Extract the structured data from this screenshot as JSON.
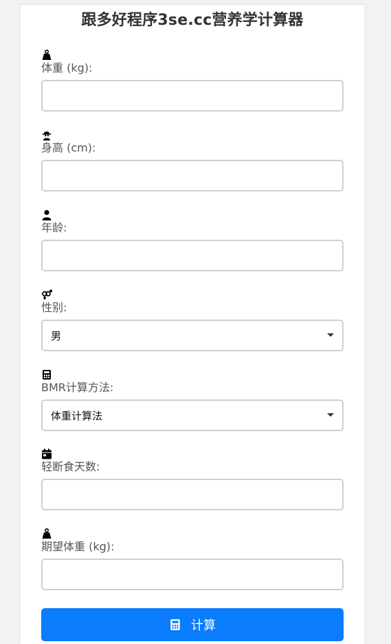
{
  "form": {
    "title": "跟多好程序3se.cc营养学计算器",
    "fields": [
      {
        "icon": "weight-icon",
        "label": "体重 (kg):",
        "value": "",
        "placeholder": ""
      },
      {
        "icon": "height-icon",
        "label": "身高 (cm):",
        "value": "",
        "placeholder": ""
      },
      {
        "icon": "user-icon",
        "label": "年龄:",
        "value": "",
        "placeholder": ""
      },
      {
        "icon": "gender-icon",
        "label": "性别:",
        "value": "男"
      },
      {
        "icon": "calculator-icon",
        "label": "BMR计算方法:",
        "value": "体重计算法"
      },
      {
        "icon": "calendar-icon",
        "label": "轻断食天数:",
        "value": "",
        "placeholder": ""
      },
      {
        "icon": "weight-icon",
        "label": "期望体重 (kg):",
        "value": "",
        "placeholder": ""
      }
    ],
    "submit": {
      "icon": "calculator-icon",
      "label": "计算"
    }
  },
  "colors": {
    "accent": "#0a7cfc",
    "background": "#f2f2f2",
    "card": "#ffffff",
    "label_text": "#555555",
    "input_border": "#cfcfcf"
  }
}
